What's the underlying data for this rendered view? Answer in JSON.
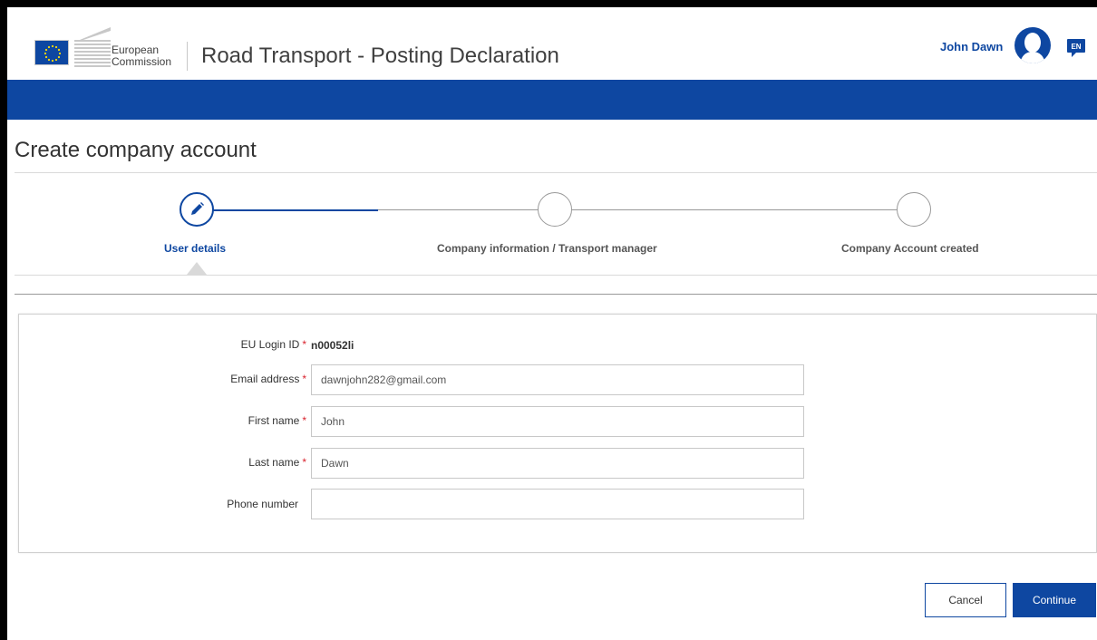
{
  "header": {
    "logo_line1": "European",
    "logo_line2": "Commission",
    "app_title": "Road Transport - Posting Declaration",
    "user_name": "John Dawn",
    "language": "EN",
    "brand_color": "#0e47a1"
  },
  "page": {
    "title": "Create company account"
  },
  "stepper": {
    "steps": [
      {
        "label": "User details",
        "state": "active",
        "icon": "pencil-icon"
      },
      {
        "label": "Company information / Transport manager",
        "state": "pending"
      },
      {
        "label": "Company Account created",
        "state": "pending"
      }
    ]
  },
  "form": {
    "eu_login": {
      "label": "EU Login ID",
      "value": "n00052li",
      "required": true
    },
    "email": {
      "label": "Email address",
      "value": "dawnjohn282@gmail.com",
      "required": true
    },
    "first_name": {
      "label": "First name",
      "value": "John",
      "required": true
    },
    "last_name": {
      "label": "Last name",
      "value": "Dawn",
      "required": true
    },
    "phone": {
      "label": "Phone number",
      "value": "",
      "required": false
    },
    "required_marker": "*"
  },
  "actions": {
    "cancel_label": "Cancel",
    "continue_label": "Continue"
  }
}
